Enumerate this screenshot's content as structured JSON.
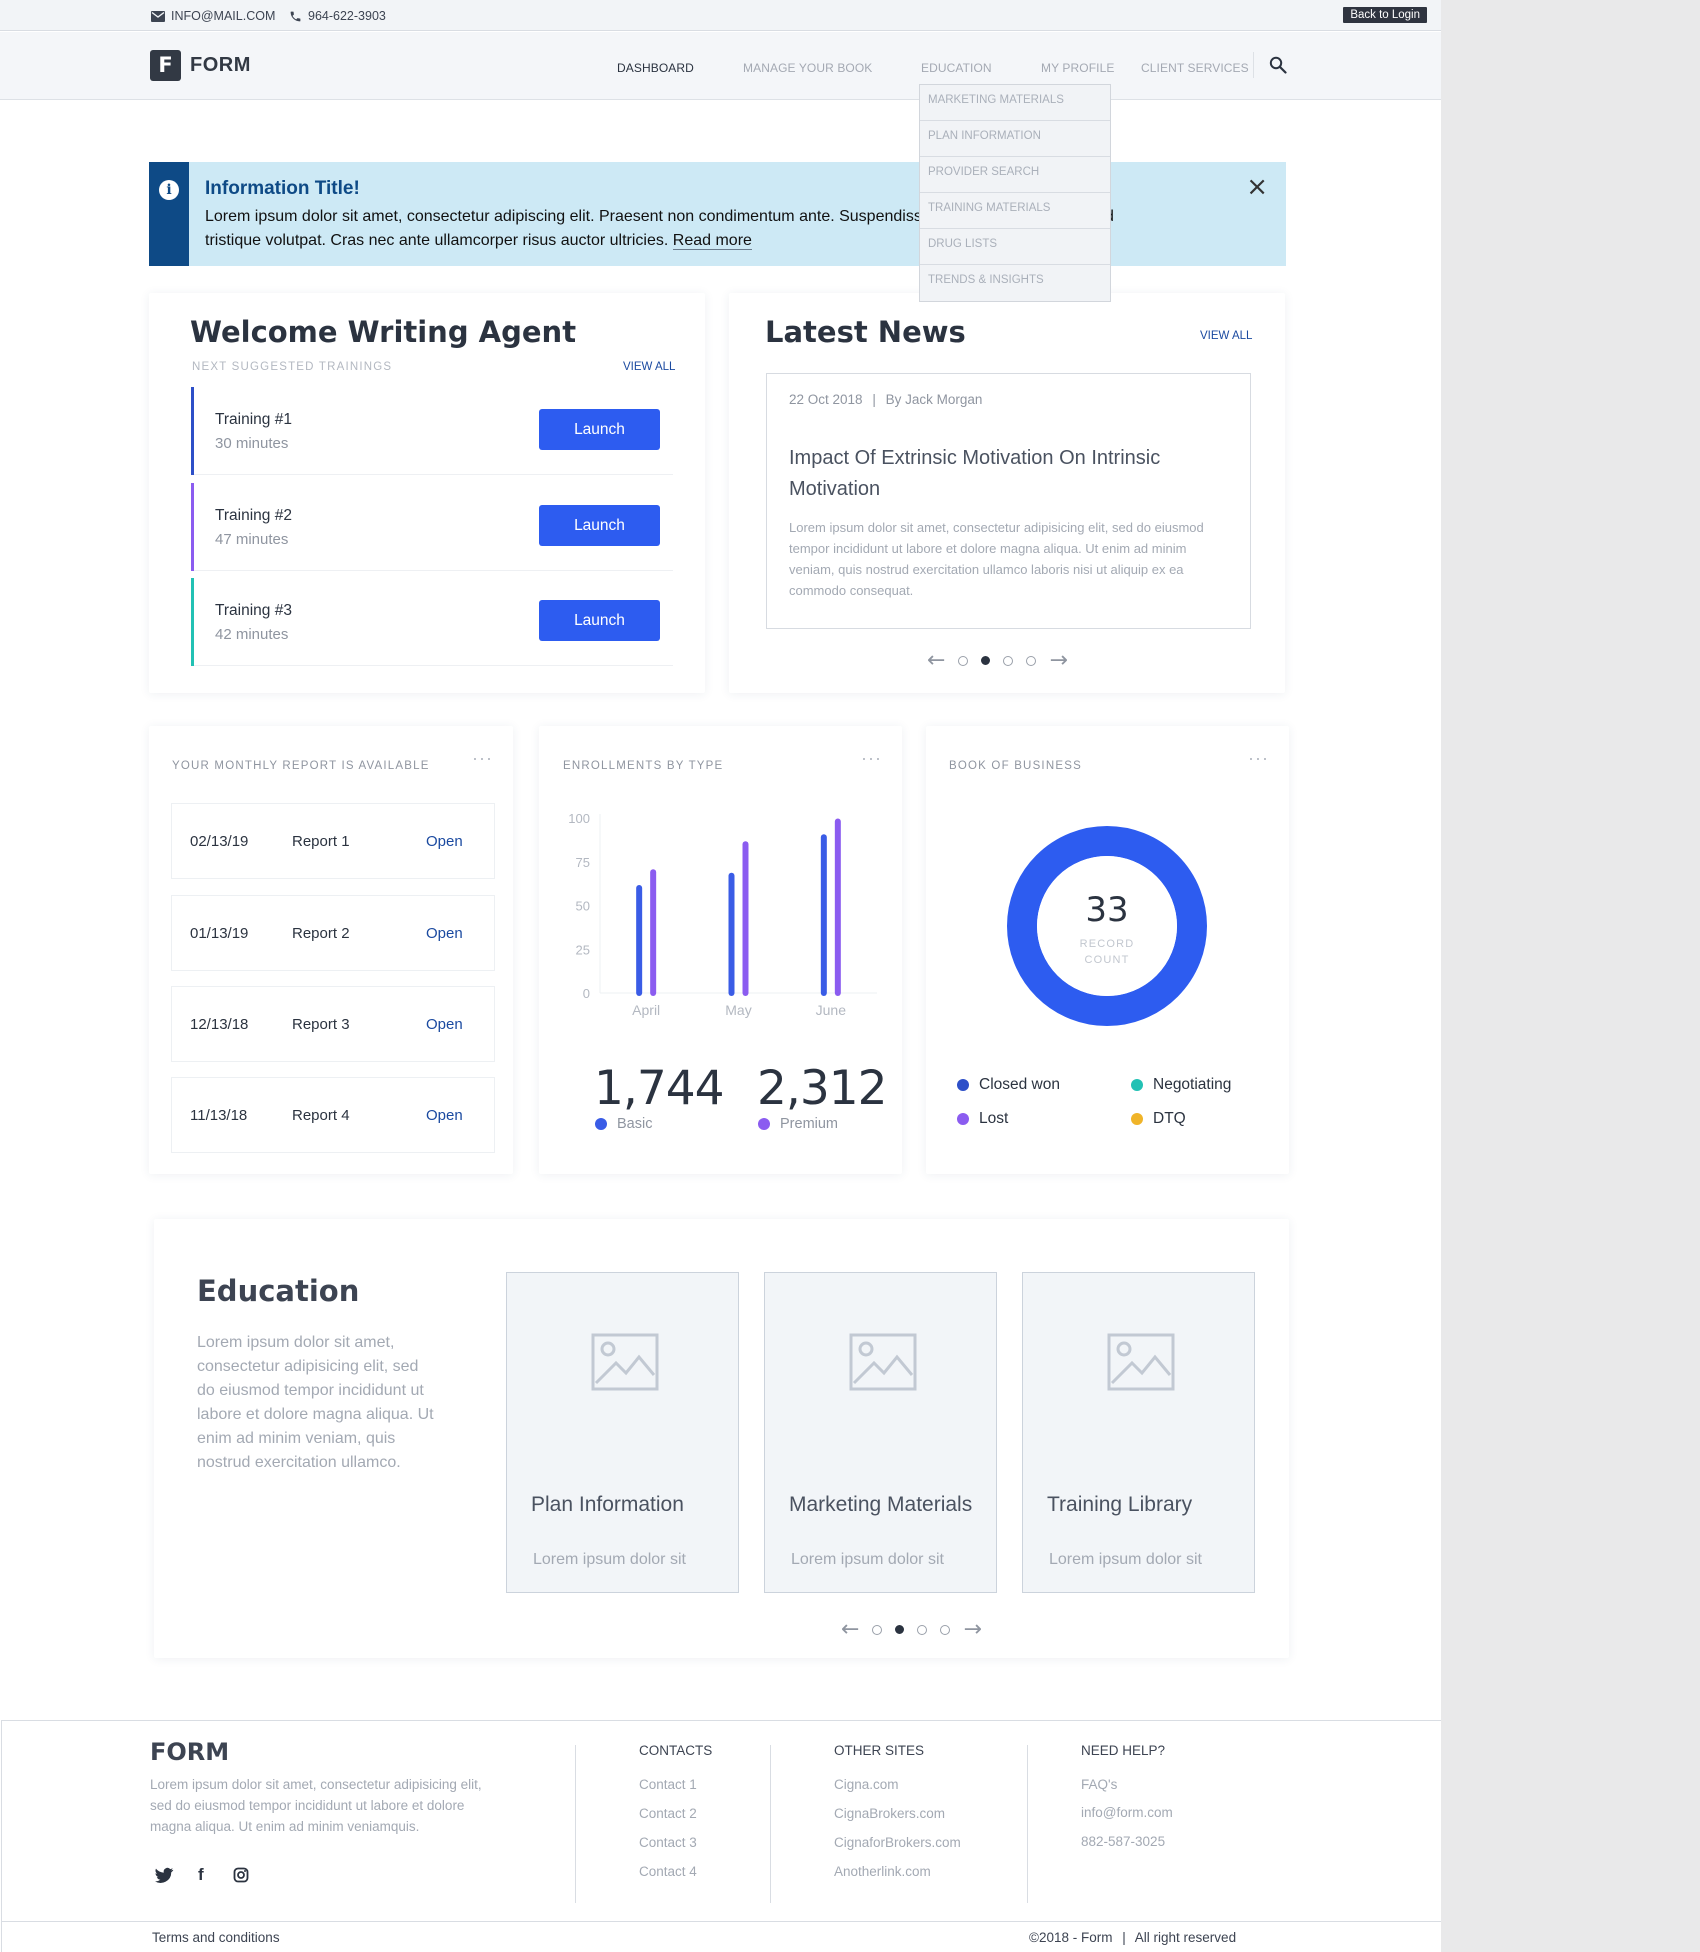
{
  "topbar": {
    "email": "INFO@MAIL.COM",
    "phone": "964-622-3903",
    "login": "Back to Login"
  },
  "nav": {
    "logo_letter": "F",
    "logo_text": "FORM",
    "links": [
      "DASHBOARD",
      "MANAGE YOUR BOOK",
      "EDUCATION",
      "MY PROFILE",
      "CLIENT SERVICES"
    ],
    "dropdown": [
      "MARKETING MATERIALS",
      "PLAN INFORMATION",
      "PROVIDER SEARCH",
      "TRAINING MATERIALS",
      "DRUG LISTS",
      "TRENDS & INSIGHTS"
    ]
  },
  "alert": {
    "title": "Information Title!",
    "body_prefix": "Lorem ipsum dolor sit amet, consectetur adipiscing elit. Praesent non condimentum ante. Suspendisse potenti. Nulla facilisi. Sed tristique volutpat. Cras nec ante ullamcorper risus auctor ultricies.",
    "read_more": "Read more"
  },
  "welcome": {
    "title": "Welcome Writing Agent",
    "subtitle": "NEXT SUGGESTED TRAININGS",
    "view_all": "VIEW ALL",
    "trainings": [
      {
        "name": "Training #1",
        "duration": "30 minutes",
        "button": "Launch",
        "color": "#2d4fc8"
      },
      {
        "name": "Training #2",
        "duration": "47 minutes",
        "button": "Launch",
        "color": "#8b5cf0"
      },
      {
        "name": "Training #3",
        "duration": "42 minutes",
        "button": "Launch",
        "color": "#22c1b4"
      }
    ]
  },
  "news": {
    "title": "Latest News",
    "view_all": "VIEW ALL",
    "date": "22 Oct 2018",
    "by": "By",
    "author": "Jack Morgan",
    "headline": "Impact Of Extrinsic Motivation On Intrinsic Motivation",
    "body": "Lorem ipsum dolor sit amet, consectetur adipisicing elit, sed do eiusmod tempor incididunt ut labore et dolore magna aliqua. Ut enim ad minim veniam, quis nostrud exercitation ullamco laboris nisi ut aliquip ex ea commodo consequat.",
    "active_dot": 1
  },
  "reports": {
    "title": "YOUR MONTHLY REPORT IS AVAILABLE",
    "rows": [
      {
        "date": "02/13/19",
        "name": "Report 1",
        "action": "Open"
      },
      {
        "date": "01/13/19",
        "name": "Report 2",
        "action": "Open"
      },
      {
        "date": "12/13/18",
        "name": "Report 3",
        "action": "Open"
      },
      {
        "date": "11/13/18",
        "name": "Report 4",
        "action": "Open"
      }
    ]
  },
  "enrollments": {
    "title": "ENROLLMENTS BY TYPE",
    "basic_total": "1,744",
    "basic_label": "Basic",
    "premium_total": "2,312",
    "premium_label": "Premium"
  },
  "chart_data": {
    "type": "bar",
    "title": "ENROLLMENTS BY TYPE",
    "categories": [
      "April",
      "May",
      "June"
    ],
    "series": [
      {
        "name": "Basic",
        "values": [
          60,
          67,
          89
        ],
        "color": "#3a5ce6"
      },
      {
        "name": "Premium",
        "values": [
          69,
          85,
          98
        ],
        "color": "#8b5cf0"
      }
    ],
    "yticks": [
      0,
      25,
      50,
      75,
      100
    ],
    "ylim": [
      0,
      100
    ]
  },
  "book": {
    "title": "BOOK OF BUSINESS",
    "count": "33",
    "count_label_1": "RECORD",
    "count_label_2": "COUNT",
    "legend": [
      {
        "label": "Closed won",
        "color": "#2d4fc8"
      },
      {
        "label": "Negotiating",
        "color": "#22c1b4"
      },
      {
        "label": "Lost",
        "color": "#8b5cf0"
      },
      {
        "label": "DTQ",
        "color": "#f0b429"
      }
    ],
    "ring_color": "#2d5cf0"
  },
  "education": {
    "title": "Education",
    "body": "Lorem ipsum dolor sit amet, consectetur adipisicing elit, sed do eiusmod tempor incididunt ut labore et dolore magna aliqua. Ut enim ad minim veniam, quis nostrud exercitation ullamco.",
    "cards": [
      {
        "title": "Plan Information",
        "subtitle": "Lorem ipsum dolor sit"
      },
      {
        "title": "Marketing Materials",
        "subtitle": "Lorem ipsum dolor sit"
      },
      {
        "title": "Training Library",
        "subtitle": "Lorem ipsum dolor sit"
      }
    ],
    "active_dot": 1
  },
  "footer": {
    "brand": "FORM",
    "about": "Lorem ipsum dolor sit amet, consectetur adipisicing elit, sed do eiusmod tempor incididunt ut labore et dolore magna aliqua. Ut enim ad minim veniamquis.",
    "contacts_title": "CONTACTS",
    "contacts": [
      "Contact 1",
      "Contact 2",
      "Contact 3",
      "Contact 4"
    ],
    "other_title": "OTHER SITES",
    "other": [
      "Cigna.com",
      "CignaBrokers.com",
      "CignaforBrokers.com",
      "Anotherlink.com"
    ],
    "help_title": "NEED HELP?",
    "help": [
      "FAQ's",
      "info@form.com",
      "882-587-3025"
    ],
    "terms": "Terms and conditions",
    "copyright": "©2018 - Form",
    "rights": "All right reserved"
  }
}
